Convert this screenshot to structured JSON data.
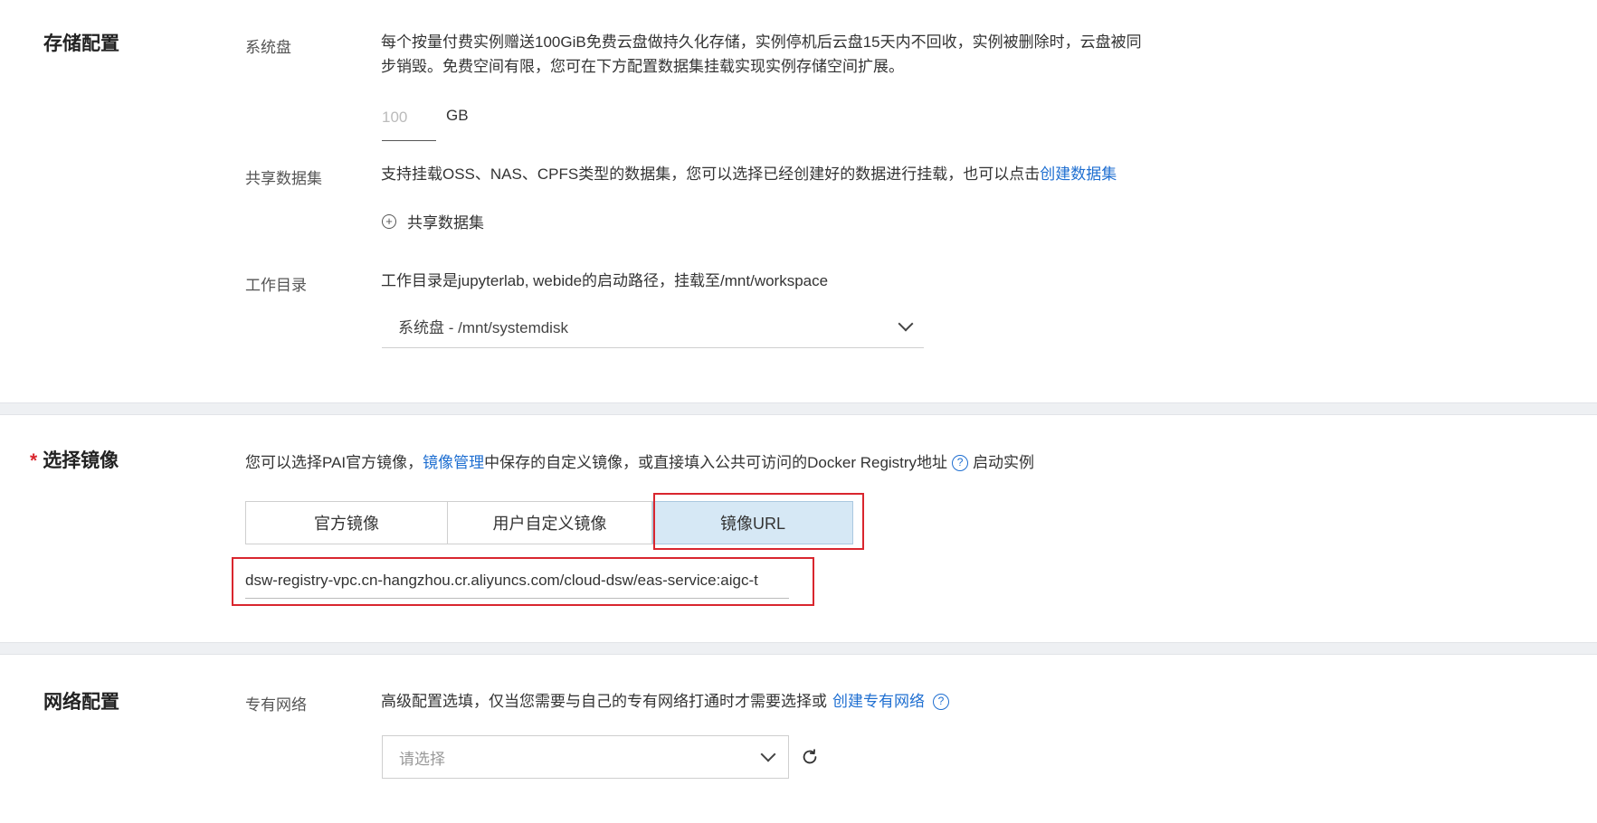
{
  "storage": {
    "title": "存储配置",
    "system_disk": {
      "label": "系统盘",
      "desc_line1": "每个按量付费实例赠送100GiB免费云盘做持久化存储，实例停机后云盘15天内不回收，实例被删除时，云盘被同",
      "desc_line2": "步销毁。免费空间有限，您可在下方配置数据集挂载实现实例存储空间扩展。",
      "size_placeholder": "100",
      "size_unit": "GB"
    },
    "shared_dataset": {
      "label": "共享数据集",
      "desc": "支持挂载OSS、NAS、CPFS类型的数据集，您可以选择已经创建好的数据进行挂载，也可以点击",
      "create_link": "创建数据集",
      "add_label": "共享数据集"
    },
    "work_dir": {
      "label": "工作目录",
      "desc": "工作目录是jupyterlab, webide的启动路径，挂载至/mnt/workspace",
      "selected": "系统盘 - /mnt/systemdisk"
    }
  },
  "image": {
    "required_mark": "*",
    "title": "选择镜像",
    "desc_prefix": "您可以选择PAI官方镜像，",
    "desc_link": "镜像管理",
    "desc_suffix": "中保存的自定义镜像，或直接填入公共可访问的Docker Registry地址",
    "desc_tail": "启动实例",
    "tabs": [
      "官方镜像",
      "用户自定义镜像",
      "镜像URL"
    ],
    "active_tab": "镜像URL",
    "url_value": "dsw-registry-vpc.cn-hangzhou.cr.aliyuncs.com/cloud-dsw/eas-service:aigc-t"
  },
  "network": {
    "title": "网络配置",
    "vpc": {
      "label": "专有网络",
      "desc": "高级配置选填，仅当您需要与自己的专有网络打通时才需要选择或",
      "create_link": "创建专有网络",
      "placeholder": "请选择"
    }
  },
  "colors": {
    "link": "#1f6fd1",
    "highlight_border": "#d9262e",
    "active_tab_bg": "#d6e8f5",
    "divider_bg": "#eef0f3"
  },
  "icons": [
    "plus-circle-icon",
    "chevron-down-icon",
    "help-icon",
    "refresh-icon"
  ]
}
